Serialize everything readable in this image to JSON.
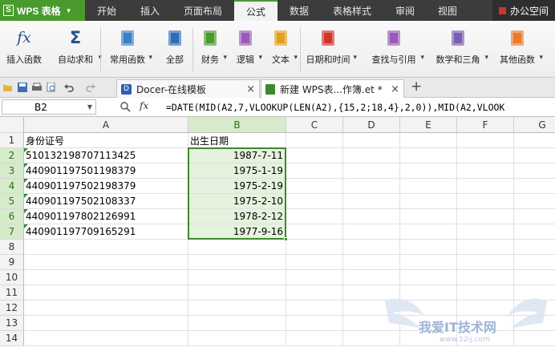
{
  "app": {
    "name": "WPS 表格",
    "logo": "S"
  },
  "menu_tabs": [
    "开始",
    "插入",
    "页面布局",
    "公式",
    "数据",
    "表格样式",
    "审阅",
    "视图"
  ],
  "active_menu": "公式",
  "office_space": "办公空间",
  "ribbon": [
    {
      "label": "插入函数",
      "icon": "fx-icon"
    },
    {
      "label": "自动求和",
      "icon": "sigma-icon"
    },
    {
      "label": "常用函数",
      "icon": "common-func-icon"
    },
    {
      "label": "全部",
      "icon": "all-func-icon"
    },
    {
      "label": "财务",
      "icon": "finance-icon"
    },
    {
      "label": "逻辑",
      "icon": "logic-icon"
    },
    {
      "label": "文本",
      "icon": "text-func-icon"
    },
    {
      "label": "日期和时间",
      "icon": "datetime-icon"
    },
    {
      "label": "查找与引用",
      "icon": "lookup-icon"
    },
    {
      "label": "数学和三角",
      "icon": "math-icon"
    },
    {
      "label": "其他函数",
      "icon": "other-func-icon"
    }
  ],
  "doc_tabs": [
    {
      "label": "Docer-在线模板",
      "close": "×"
    },
    {
      "label": "新建 WPS表...作簿.et *",
      "close": "×"
    }
  ],
  "new_tab": "+",
  "namebox": {
    "value": "B2"
  },
  "fx": "fx",
  "formula": "=DATE(MID(A2,7,VLOOKUP(LEN(A2),{15,2;18,4},2,0)),MID(A2,VLOOK",
  "columns": [
    "A",
    "B",
    "C",
    "D",
    "E",
    "F",
    "G"
  ],
  "selected_column": "B",
  "rows": [
    {
      "n": "1",
      "a": "身份证号",
      "b": ""
    },
    {
      "n": "2",
      "a": "510132198707113425",
      "b": "1987-7-11"
    },
    {
      "n": "3",
      "a": "440901197501198379",
      "b": "1975-1-19"
    },
    {
      "n": "4",
      "a": "440901197502198379",
      "b": "1975-2-19"
    },
    {
      "n": "5",
      "a": "440901197502108337",
      "b": "1975-2-10"
    },
    {
      "n": "6",
      "a": "440901197802126991",
      "b": "1978-2-12"
    },
    {
      "n": "7",
      "a": "440901197709165291",
      "b": "1977-9-16"
    },
    {
      "n": "8",
      "a": "",
      "b": ""
    },
    {
      "n": "9",
      "a": "",
      "b": ""
    },
    {
      "n": "10",
      "a": "",
      "b": ""
    },
    {
      "n": "11",
      "a": "",
      "b": ""
    },
    {
      "n": "12",
      "a": "",
      "b": ""
    },
    {
      "n": "13",
      "a": "",
      "b": ""
    },
    {
      "n": "14",
      "a": "",
      "b": ""
    }
  ],
  "b1_header": "出生日期",
  "watermark": {
    "main": "我爱IT技术网",
    "url": "www.52ij.com"
  },
  "colors": {
    "accent": "#4a9a2e",
    "selection": "#3d8a2c",
    "titlebar": "#3c3c3c"
  }
}
